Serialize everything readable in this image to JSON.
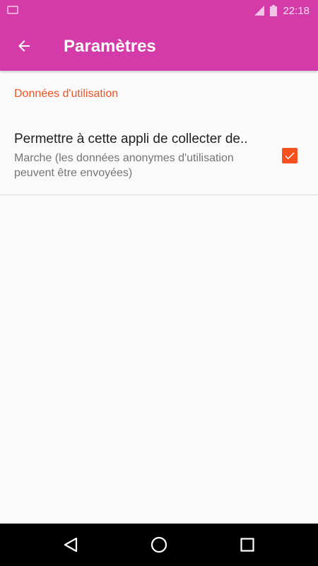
{
  "status_bar": {
    "time": "22:18",
    "icons": [
      "notification-icon",
      "signal-icon",
      "battery-icon"
    ]
  },
  "app_bar": {
    "title": "Paramètres",
    "back_icon": "arrow-back-icon",
    "color": "#d43aa8"
  },
  "section": {
    "header": "Données d'utilisation",
    "color": "#f4511e"
  },
  "preference": {
    "title": "Permettre à cette appli de collecter de..",
    "summary": "Marche (les données anonymes d'utilisation peuvent être envoyées)",
    "checked": true
  },
  "nav_bar": {
    "icons": [
      "back-triangle-icon",
      "home-circle-icon",
      "recents-square-icon"
    ]
  }
}
